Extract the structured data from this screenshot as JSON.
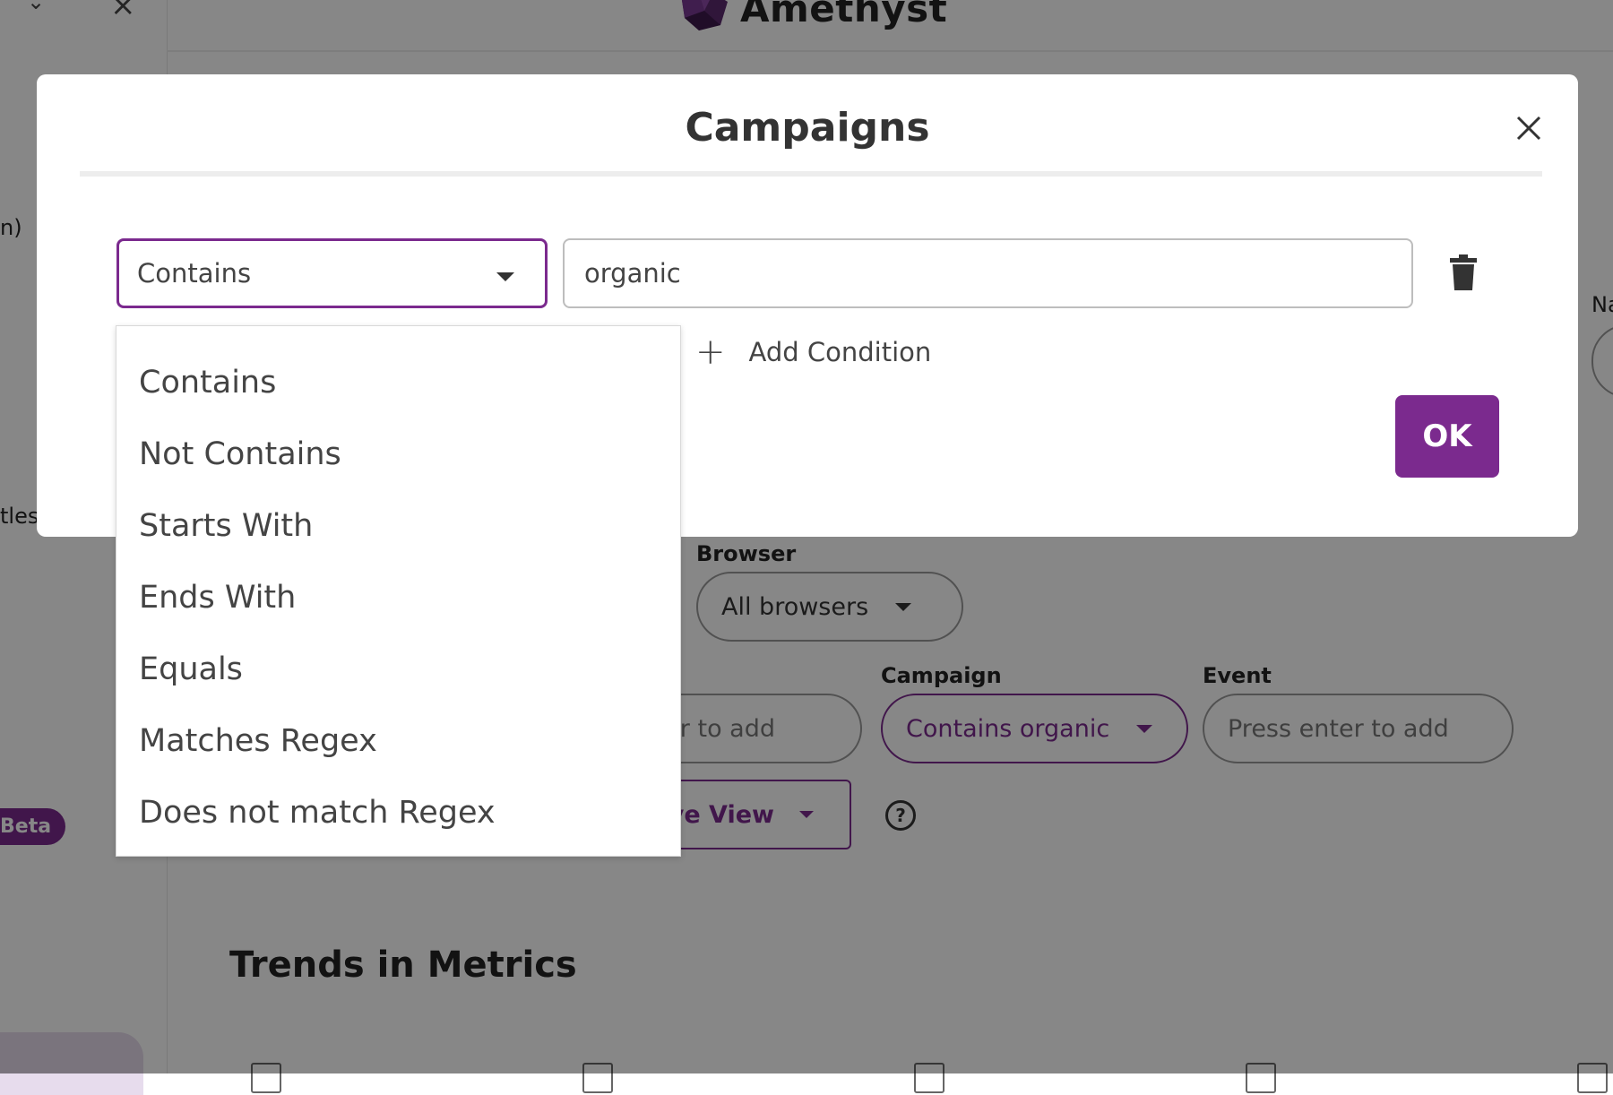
{
  "app": {
    "logo_text": "Amethyst",
    "sidebar": {
      "fragment_1": "n)",
      "fragment_2": "tles",
      "beta_badge": "Beta"
    },
    "right_fragment": "Na",
    "filters": {
      "browser_label": "Browser",
      "browser_value": "All browsers",
      "partial_input_placeholder": "er to add",
      "campaign_label": "Campaign",
      "campaign_value": "Contains organic",
      "event_label": "Event",
      "event_placeholder": "Press enter to add",
      "view_button_partial": "ve View"
    },
    "section_title": "Trends in Metrics"
  },
  "modal": {
    "title": "Campaigns",
    "condition": {
      "operator": "Contains",
      "value": "organic"
    },
    "add_condition_label": "Add Condition",
    "ok_label": "OK"
  },
  "dropdown": {
    "options": [
      "Contains",
      "Not Contains",
      "Starts With",
      "Ends With",
      "Equals",
      "Matches Regex",
      "Does not match Regex"
    ]
  },
  "colors": {
    "accent": "#7b2a8e",
    "overlay": "rgba(0,0,0,0.47)"
  }
}
